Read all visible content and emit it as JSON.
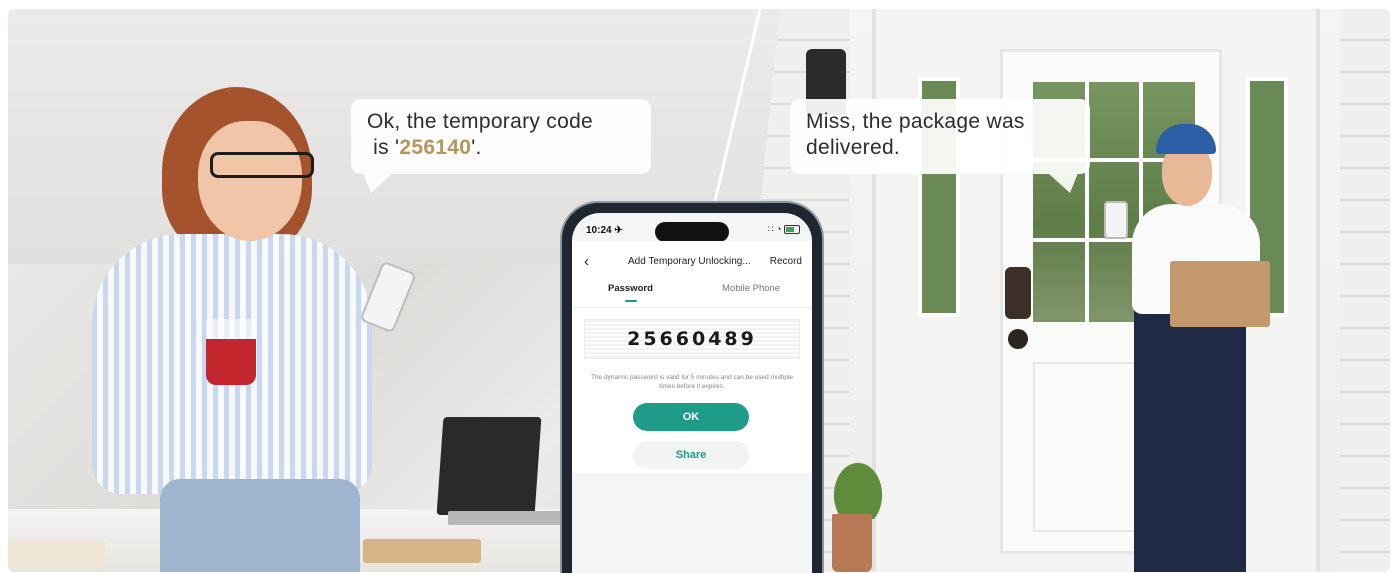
{
  "bubbles": {
    "left_line1": "Ok, the temporary code",
    "left_prefix": "is '",
    "left_code": "256140",
    "left_suffix": "'.",
    "right_line1": "Miss, the package was",
    "right_line2": "delivered."
  },
  "phone": {
    "status_time": "10:24 ✈",
    "status_icons": "∷ ◔",
    "nav": {
      "back_icon": "‹",
      "title": "Add Temporary Unlocking...",
      "record": "Record"
    },
    "tabs": [
      {
        "label": "Password",
        "active": true
      },
      {
        "label": "Mobile Phone",
        "active": false
      }
    ],
    "password": "25660489",
    "hint": "The dynamic password is valid for 5 minutes and can be used multiple times before it expires.",
    "ok_label": "OK",
    "share_label": "Share"
  },
  "colors": {
    "accent": "#1f9c88",
    "code_highlight": "#b8955a"
  },
  "icons": [
    "back-chevron-icon",
    "battery-icon",
    "signal-icon"
  ]
}
